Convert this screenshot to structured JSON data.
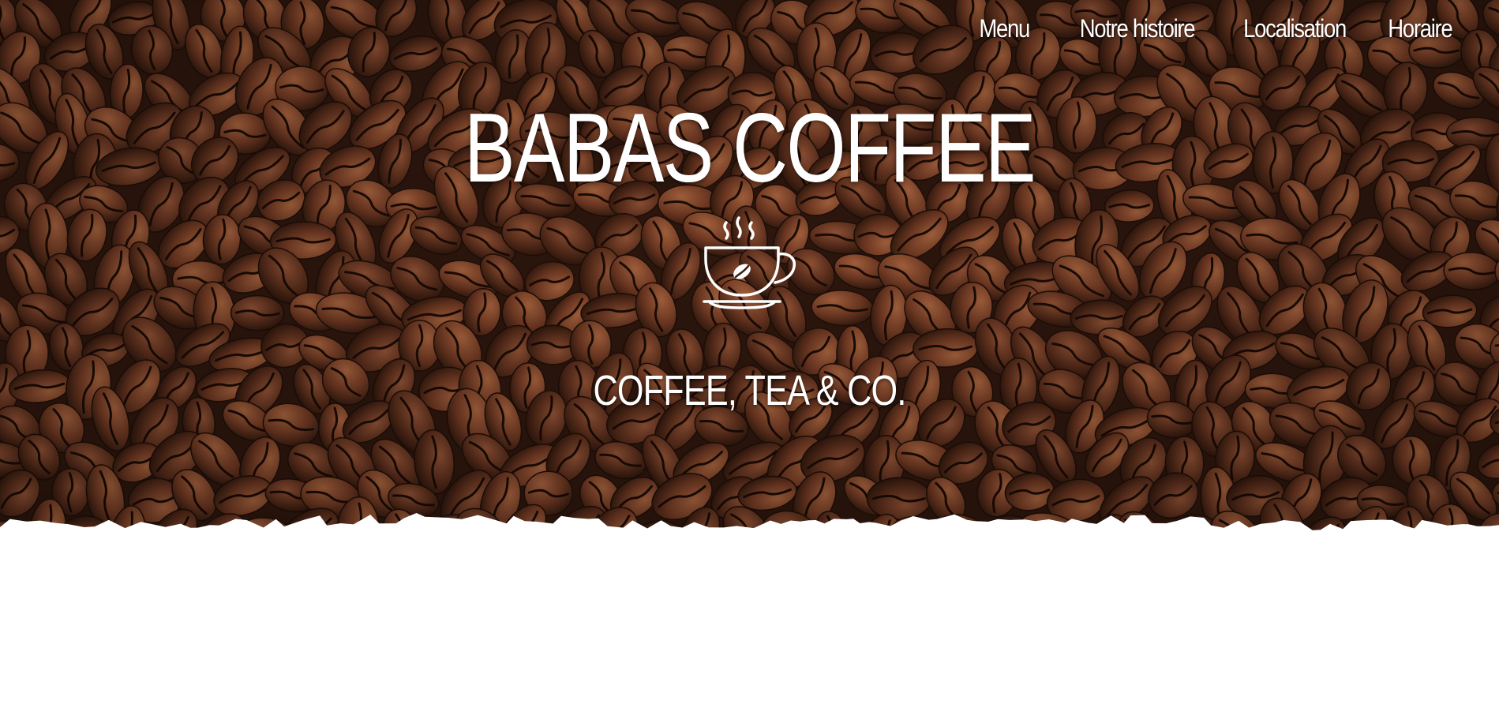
{
  "nav": {
    "items": [
      {
        "label": "Menu"
      },
      {
        "label": "Notre histoire"
      },
      {
        "label": "Localisation"
      },
      {
        "label": "Horaire"
      }
    ]
  },
  "hero": {
    "title": "BABAS COFFEE",
    "tagline": "COFFEE, TEA & CO.",
    "icon": "coffee-cup-icon",
    "background": "coffee-beans-photo"
  },
  "colors": {
    "text": "#ffffff",
    "bean_dark": "#2a150c",
    "bean_mid": "#5a2e1c",
    "bean_light": "#8a4a2c",
    "page_bg": "#ffffff"
  }
}
